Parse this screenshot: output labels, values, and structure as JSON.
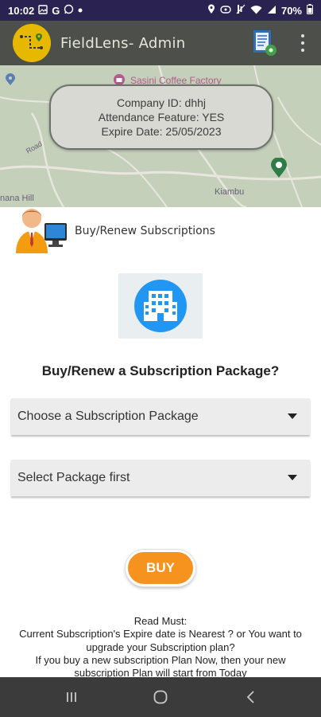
{
  "status_bar": {
    "time": "10:02",
    "left_icons": [
      "gallery-icon",
      "google-icon",
      "whatsapp-icon",
      "dot-icon"
    ],
    "right_icons": [
      "location-icon",
      "link-icon",
      "mute-icon",
      "wifi-icon",
      "signal-icon"
    ],
    "battery": "70%"
  },
  "app_bar": {
    "title": "FieldLens- Admin",
    "brand_color": "#e7b800",
    "bar_color": "#4d4f4a"
  },
  "map": {
    "poi_label": "Sasini Coffee Factory",
    "road_label": "Road",
    "place_left": "nana Hill",
    "place_right": "Kiambu",
    "info": {
      "company_line": "Company ID: dhhj",
      "attendance_line": "Attendance Feature: YES",
      "expire_line": "Expire Date: 25/05/2023"
    }
  },
  "sheet": {
    "title": "Buy/Renew Subscriptions",
    "question": "Buy/Renew a Subscription Package?",
    "package_dropdown": "Choose a Subscription Package",
    "plan_dropdown": "Select Package first",
    "buy_label": "BUY",
    "buy_color": "#f6921e",
    "notes": {
      "line1": "Read Must:",
      "line2": "Current Subscription's Expire date is Nearest ? or You want to upgrade your Subscription plan?",
      "line3": "If you buy a new subscription Plan Now, then your new subscription Plan will start from Today"
    }
  },
  "nav": {
    "recents_glyph": "|||",
    "home_glyph": "◯",
    "back_glyph": "‹"
  }
}
